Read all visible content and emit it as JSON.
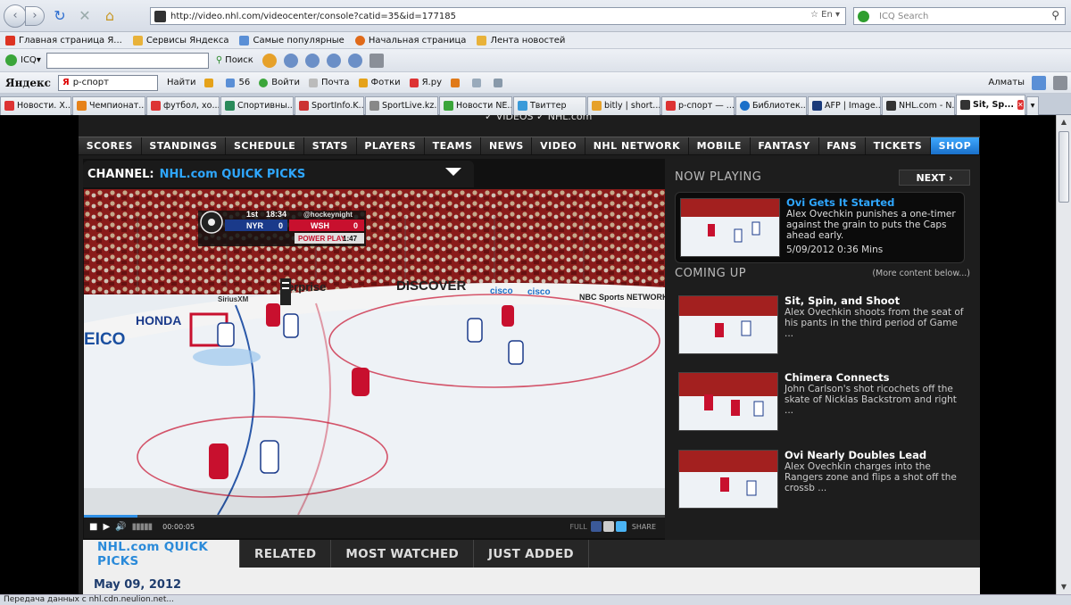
{
  "browser": {
    "url": "http://video.nhl.com/videocenter/console?catid=35&id=177185",
    "url_lang": "En",
    "search_placeholder": "ICQ Search",
    "bookmarks": [
      "Главная страница Я...",
      "Сервисы Яндекса",
      "Самые популярные",
      "Начальная страница",
      "Лента новостей"
    ],
    "icq_label": "ICQ",
    "find_label": "Поиск",
    "yandex": {
      "logo": "Яндекс",
      "query": "р-спорт",
      "find": "Найти",
      "counter": "56",
      "login": "Войти",
      "mail": "Почта",
      "photos": "Фотки",
      "yaru": "Я.ру",
      "city": "Алматы"
    },
    "tabs": [
      "Новости. Х...",
      "Чемпионат...",
      "футбол, хо...",
      "Спортивны...",
      "SportInfo.K...",
      "SportLive.kz...",
      "Новости NE...",
      "Твиттер",
      "bitly | short...",
      "р-спорт — ...",
      "Библиотек...",
      "AFP | Image...",
      "NHL.com - N...",
      "Sit, Sp..."
    ],
    "status_text": "Передача данных с nhl.cdn.neulion.net..."
  },
  "site": {
    "top_links": "✓ VIDEOS  ✓ NHL.com",
    "nav": [
      "SCORES",
      "STANDINGS",
      "SCHEDULE",
      "STATS",
      "PLAYERS",
      "TEAMS",
      "NEWS",
      "VIDEO",
      "NHL NETWORK",
      "MOBILE",
      "FANTASY",
      "FANS",
      "TICKETS",
      "SHOP"
    ],
    "channel_label": "CHANNEL:",
    "channel_value": "NHL.com QUICK PICKS",
    "player": {
      "time": "00:00:05",
      "full": "FULL",
      "share": "SHARE",
      "scorebug": {
        "period": "1st",
        "clock": "18:34",
        "tag": "@hockeynight",
        "away": "NYR",
        "away_score": "0",
        "home": "WSH",
        "home_score": "0",
        "situation": "POWER PLAY",
        "pp_time": "1:47"
      },
      "boards": [
        "DISCOVER",
        "cisco",
        "cisco",
        "NBC Sports NETWORK",
        "erprise",
        "HONDA",
        "EICO",
        "SiriusXM"
      ]
    },
    "now_playing_label": "NOW PLAYING",
    "next_label": "NEXT ›",
    "now_playing": {
      "title": "Ovi Gets It Started",
      "desc": "Alex Ovechkin punishes a one-timer against the grain to puts the Caps ahead early.",
      "meta": "5/09/2012  0:36 Mins"
    },
    "coming_up_label": "COMING UP",
    "more_label": "(More content below...)",
    "coming_up": [
      {
        "title": "Sit, Spin, and Shoot",
        "desc": "Alex Ovechkin shoots from the seat of his pants in the third period of Game ..."
      },
      {
        "title": "Chimera Connects",
        "desc": "John Carlson's shot ricochets off the skate of Nicklas Backstrom and right ..."
      },
      {
        "title": "Ovi Nearly Doubles Lead",
        "desc": "Alex Ovechkin charges into the Rangers zone and flips a shot off the crossb ..."
      }
    ],
    "bottom_tabs": [
      "NHL.com QUICK PICKS",
      "RELATED",
      "MOST WATCHED",
      "JUST ADDED"
    ],
    "date": "May 09, 2012"
  },
  "colors": {
    "accent_blue": "#2fa7ff",
    "shop_blue": "#1a6fc9",
    "caps_red": "#c8102e",
    "date_navy": "#1f3d6e"
  }
}
